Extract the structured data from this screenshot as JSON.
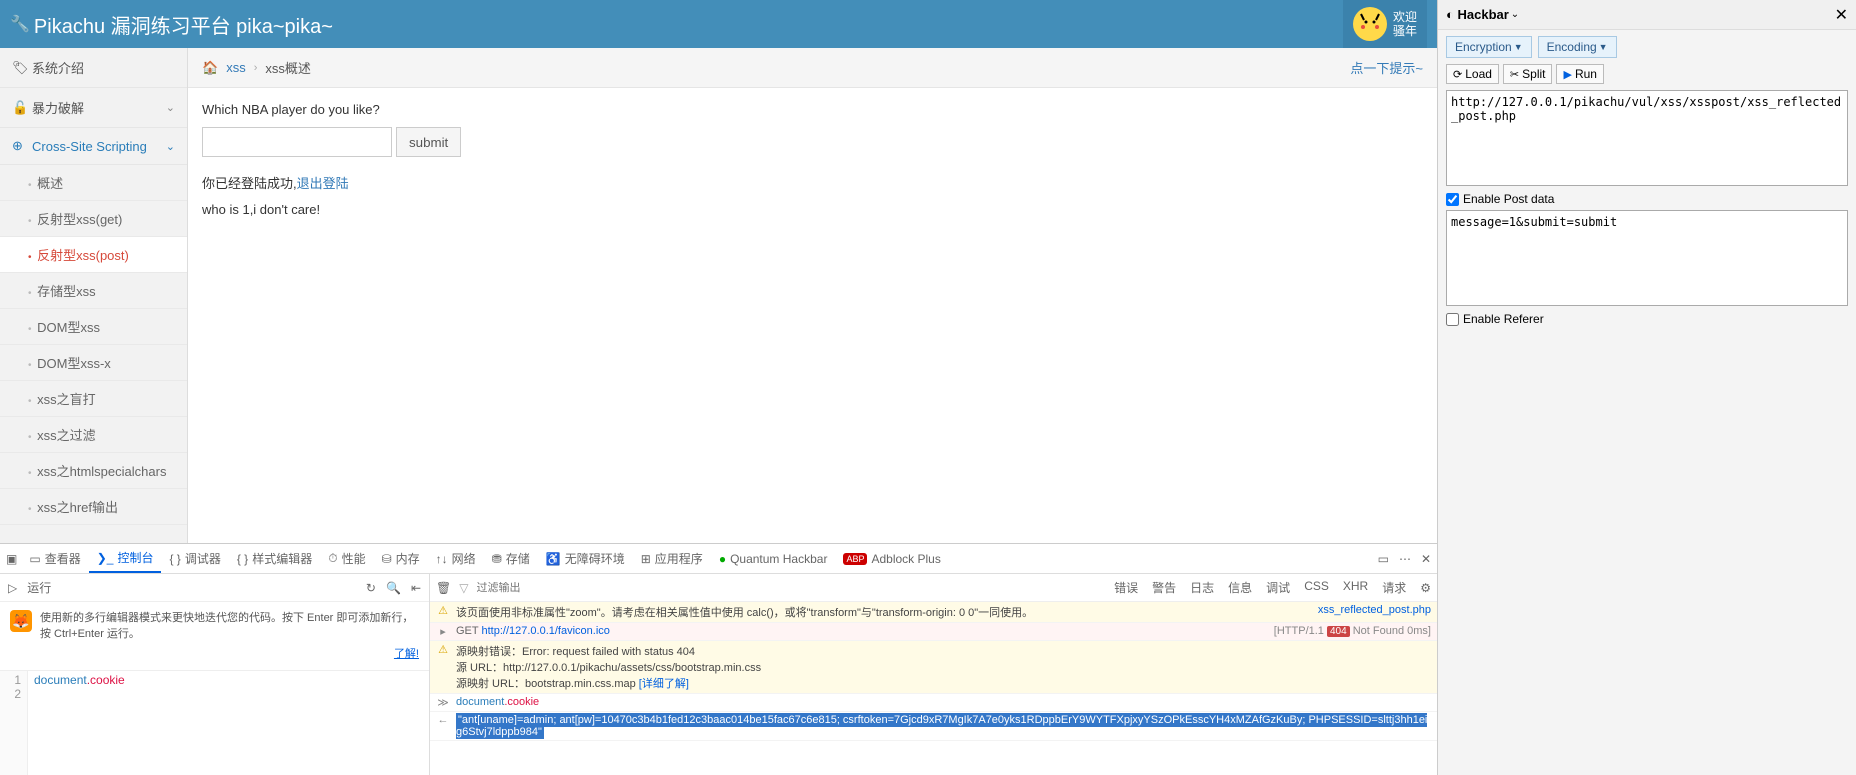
{
  "header": {
    "title": "Pikachu 漏洞练习平台 pika~pika~",
    "welcome_line1": "欢迎",
    "welcome_line2": "骚年"
  },
  "sidebar": {
    "groups": [
      {
        "icon": "🏷",
        "label": "系统介绍",
        "expandable": false
      },
      {
        "icon": "🔓",
        "label": "暴力破解",
        "expandable": true
      },
      {
        "icon": "⊕",
        "label": "Cross-Site Scripting",
        "expandable": true,
        "blue": true,
        "open": true
      }
    ],
    "xss_items": [
      {
        "label": "概述"
      },
      {
        "label": "反射型xss(get)"
      },
      {
        "label": "反射型xss(post)",
        "active": true
      },
      {
        "label": "存储型xss"
      },
      {
        "label": "DOM型xss"
      },
      {
        "label": "DOM型xss-x"
      },
      {
        "label": "xss之盲打"
      },
      {
        "label": "xss之过滤"
      },
      {
        "label": "xss之htmlspecialchars"
      },
      {
        "label": "xss之href输出"
      }
    ]
  },
  "breadcrumb": {
    "seg1": "xss",
    "seg2": "xss概述",
    "hint": "点一下提示~"
  },
  "content": {
    "question": "Which NBA player do you like?",
    "submit": "submit",
    "logged_prefix": "你已经登陆成功,",
    "logout": "退出登陆",
    "who": "who is 1,i don't care!"
  },
  "devtools": {
    "tabs": [
      "查看器",
      "控制台",
      "调试器",
      "样式编辑器",
      "性能",
      "内存",
      "网络",
      "存储",
      "无障碍环境",
      "应用程序",
      "Quantum Hackbar",
      "Adblock Plus"
    ],
    "tab_icons": [
      "▭",
      "❯_",
      "{ }",
      "{ }",
      "⏱",
      "⛁",
      "↑↓",
      "⛃",
      "♿",
      "⊞",
      "●",
      "ABP"
    ],
    "active_tab": 1,
    "run_label": "运行",
    "left_hint": "使用新的多行编辑器模式来更快地迭代您的代码。按下 Enter 即可添加新行，按 Ctrl+Enter 运行。",
    "left_hint_know": "了解!",
    "editor_obj": "document",
    "editor_prop": ".cookie",
    "filter_placeholder": "过滤输出",
    "filters": [
      "错误",
      "警告",
      "日志",
      "信息",
      "调试",
      "CSS",
      "XHR",
      "请求"
    ],
    "rows": [
      {
        "type": "warn",
        "text": "该页面使用非标准属性\"zoom\"。请考虑在相关属性值中使用 calc()，或将\"transform\"与\"transform-origin: 0 0\"一同使用。",
        "src": "xss_reflected_post.php",
        "src_link": true
      },
      {
        "type": "error",
        "text_prefix": "GET ",
        "text_url": "http://127.0.0.1/favicon.ico",
        "src_prefix": "[HTTP/1.1 ",
        "src_badge": "404",
        "src_suffix": " Not Found 0ms]"
      },
      {
        "type": "warn",
        "line1": "源映射错误：Error: request failed with status 404",
        "line2": "源 URL：http://127.0.0.1/pikachu/assets/css/bootstrap.min.css",
        "line3_a": "源映射 URL：bootstrap.min.css.map ",
        "line3_link": "[详细了解]"
      },
      {
        "type": "input",
        "obj": "document",
        "prop": ".cookie"
      },
      {
        "type": "output",
        "value": "\"ant[uname]=admin; ant[pw]=10470c3b4b1fed12c3baac014be15fac67c6e815; csrftoken=7Gjcd9xR7MgIk7A7e0yks1RDppbErY9WYTFXpjxyYSzOPkEsscYH4xMZAfGzKuBy; PHPSESSID=slttj3hh1eig6Stvj7ldppb984\""
      }
    ]
  },
  "hackbar": {
    "title": "Hackbar",
    "encryption": "Encryption",
    "encoding": "Encoding",
    "load": "Load",
    "split": "Split",
    "run": "Run",
    "url": "http://127.0.0.1/pikachu/vul/xss/xsspost/xss_reflected_post.php",
    "enable_post": "Enable Post data",
    "post_data": "message=1&submit=submit",
    "enable_referer": "Enable Referer"
  }
}
